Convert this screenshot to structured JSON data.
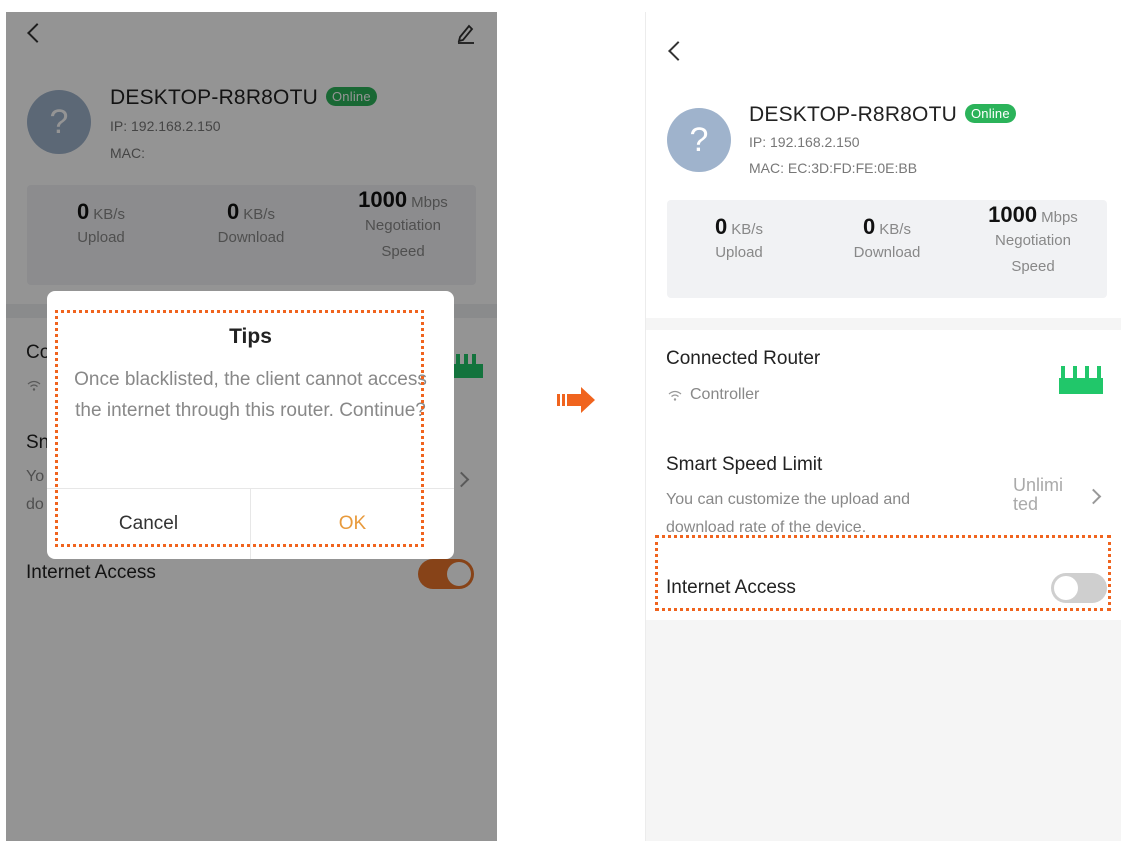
{
  "left": {
    "device": {
      "name": "DESKTOP-R8R8OTU",
      "status": "Online",
      "ip": "IP: 192.168.2.150",
      "mac_label": "MAC:"
    },
    "stats": {
      "upload": {
        "value": "0",
        "unit": "KB/s",
        "label": "Upload"
      },
      "download": {
        "value": "0",
        "unit": "KB/s",
        "label": "Download"
      },
      "speed": {
        "value": "1000",
        "unit": "Mbps",
        "label_line1": "Negotiation",
        "label_line2": "Speed"
      }
    },
    "partial": {
      "connected": "Co",
      "smart": "Sn",
      "sub1": "Yo",
      "sub2": "do"
    },
    "internet_access": "Internet Access",
    "toggle_on": true,
    "dialog": {
      "title": "Tips",
      "message": "Once blacklisted, the client cannot access the internet through this router. Continue?",
      "cancel": "Cancel",
      "ok": "OK"
    }
  },
  "right": {
    "device": {
      "name": "DESKTOP-R8R8OTU",
      "status": "Online",
      "ip": "IP: 192.168.2.150",
      "mac": "MAC: EC:3D:FD:FE:0E:BB"
    },
    "stats": {
      "upload": {
        "value": "0",
        "unit": "KB/s",
        "label": "Upload"
      },
      "download": {
        "value": "0",
        "unit": "KB/s",
        "label": "Download"
      },
      "speed": {
        "value": "1000",
        "unit": "Mbps",
        "label_line1": "Negotiation",
        "label_line2": "Speed"
      }
    },
    "connected_router": {
      "title": "Connected Router",
      "sub": "Controller"
    },
    "smart_speed": {
      "title": "Smart Speed Limit",
      "sub_line1": "You can customize the upload and",
      "sub_line2": "download rate of the device.",
      "value_line1": "Unlimi",
      "value_line2": "ted"
    },
    "internet_access": "Internet Access",
    "toggle_on": false
  },
  "colors": {
    "online_badge": "#2bb35a",
    "toggle_on": "#e8742a",
    "toggle_off": "#cfcfcf",
    "highlight": "#f0641e",
    "ok_text": "#e89a3c",
    "router_icon": "#21c76a"
  },
  "icons": {
    "back": "chevron-left-icon",
    "edit": "pencil-icon",
    "avatar": "question-mark-icon",
    "wifi": "wifi-icon",
    "router": "router-icon",
    "next": "chevron-right-icon",
    "transition": "arrow-right-icon"
  }
}
